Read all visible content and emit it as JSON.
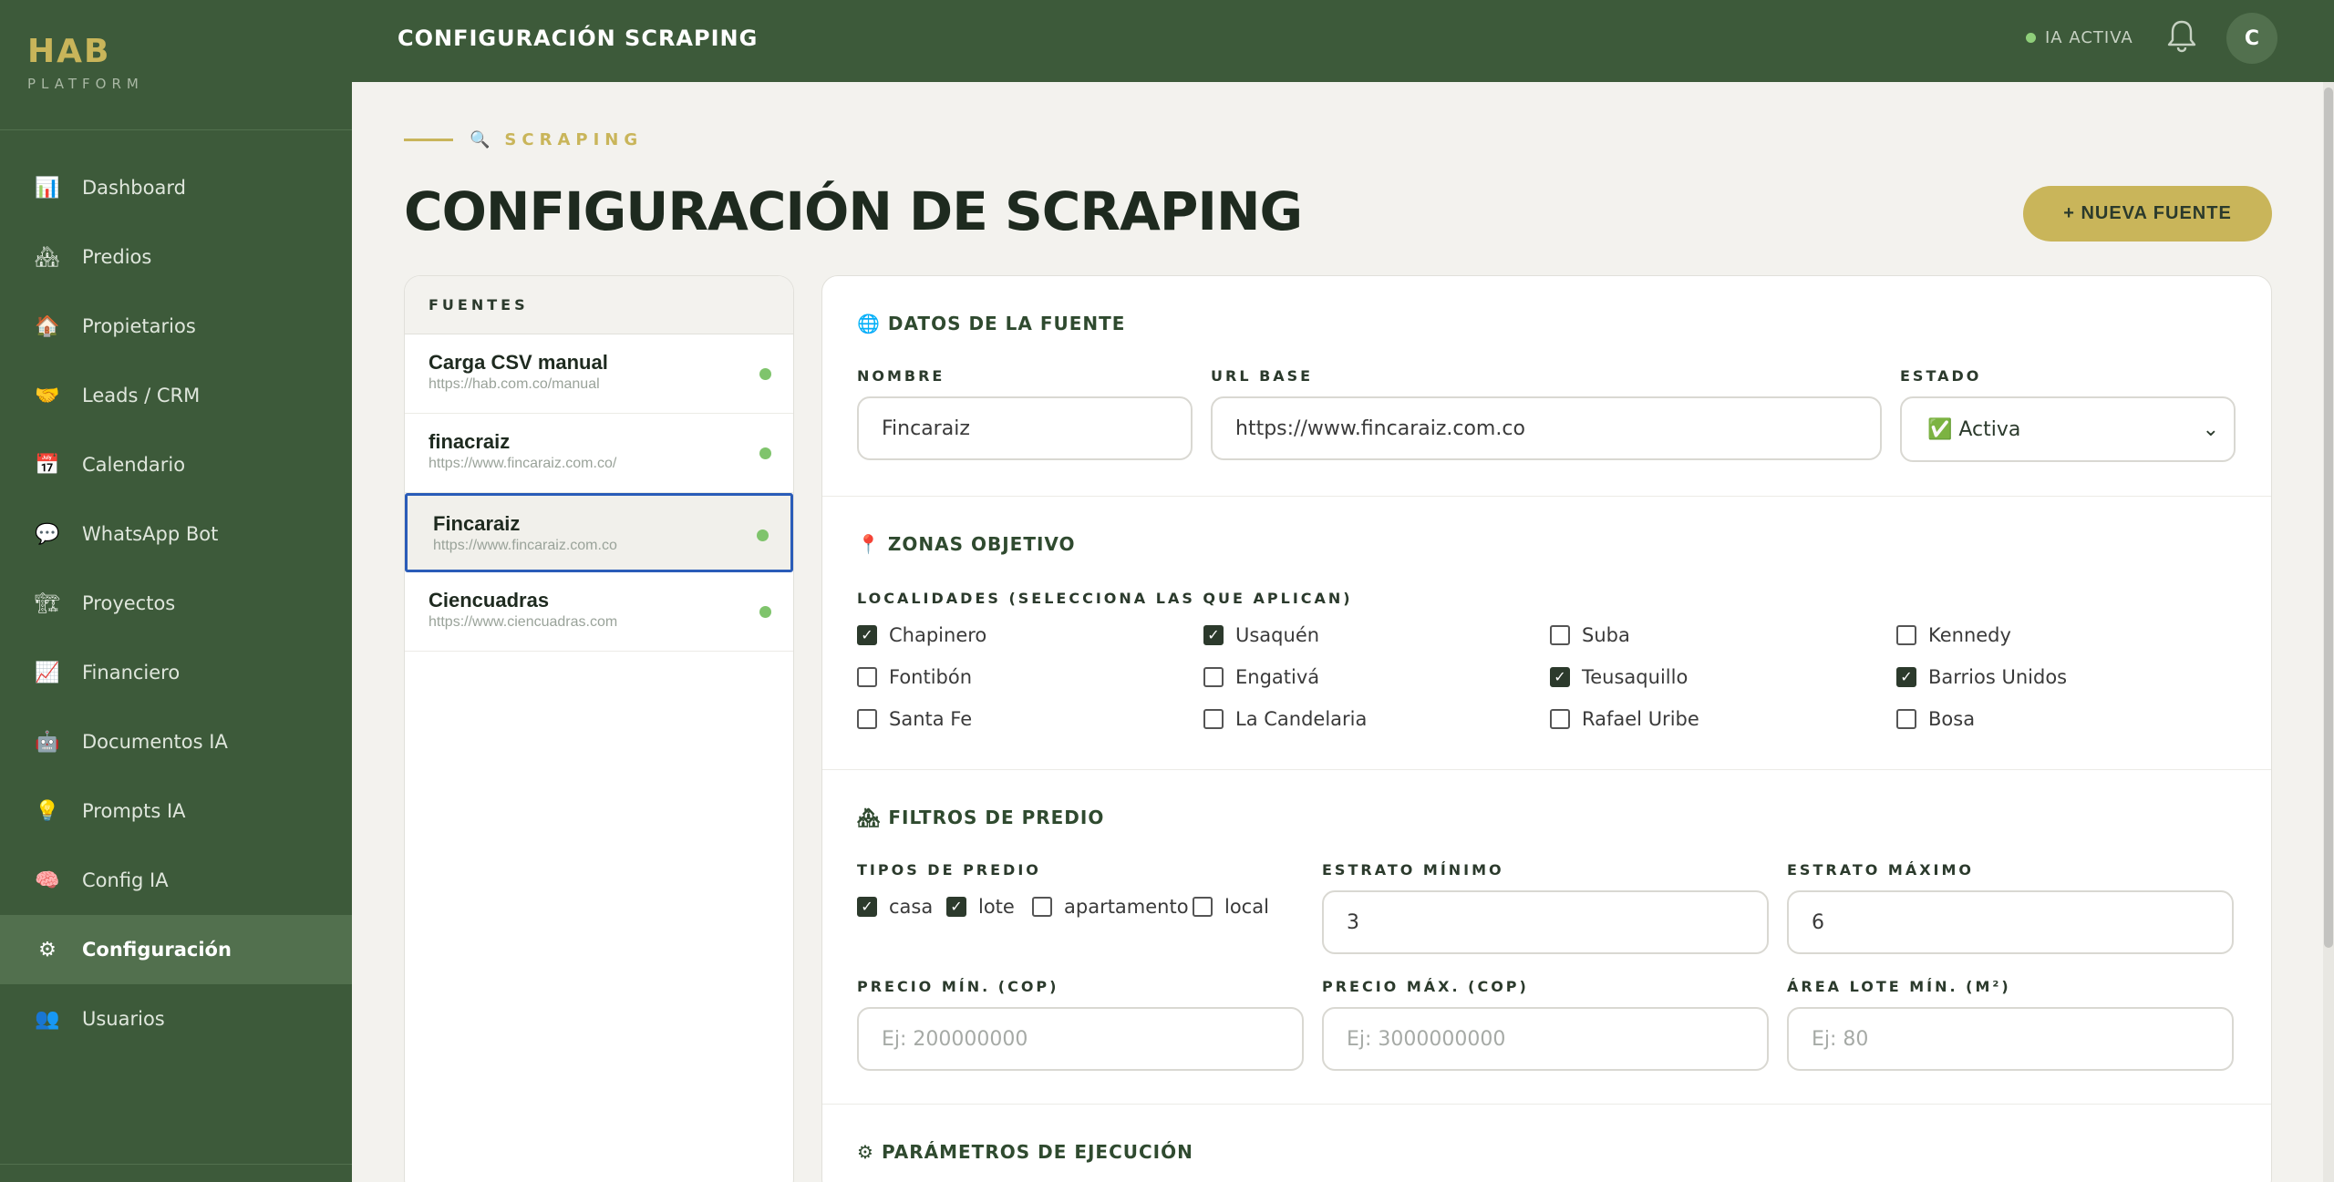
{
  "brand": {
    "name": "HAB",
    "sub": "PLATFORM"
  },
  "header": {
    "title": "CONFIGURACIÓN SCRAPING",
    "ia_status": "IA ACTIVA",
    "avatar_initial": "C"
  },
  "sidebar": {
    "items": [
      {
        "label": "Dashboard",
        "icon": "📊",
        "icon_name": "chart-icon"
      },
      {
        "label": "Predios",
        "icon": "🏘",
        "icon_name": "houses-icon"
      },
      {
        "label": "Propietarios",
        "icon": "🏠",
        "icon_name": "house-icon"
      },
      {
        "label": "Leads / CRM",
        "icon": "🤝",
        "icon_name": "handshake-icon"
      },
      {
        "label": "Calendario",
        "icon": "📅",
        "icon_name": "calendar-icon"
      },
      {
        "label": "WhatsApp Bot",
        "icon": "💬",
        "icon_name": "chat-icon"
      },
      {
        "label": "Proyectos",
        "icon": "🏗",
        "icon_name": "construction-icon"
      },
      {
        "label": "Financiero",
        "icon": "📈",
        "icon_name": "trend-icon"
      },
      {
        "label": "Documentos IA",
        "icon": "🤖",
        "icon_name": "robot-icon"
      },
      {
        "label": "Prompts IA",
        "icon": "💡",
        "icon_name": "bulb-icon"
      },
      {
        "label": "Config IA",
        "icon": "🧠",
        "icon_name": "brain-icon"
      },
      {
        "label": "Configuración",
        "icon": "⚙",
        "icon_name": "gear-icon",
        "active": true
      },
      {
        "label": "Usuarios",
        "icon": "👥",
        "icon_name": "users-icon"
      }
    ]
  },
  "page": {
    "eyebrow": "SCRAPING",
    "eyebrow_icon": "🔍",
    "title": "CONFIGURACIÓN DE SCRAPING",
    "new_source_label": "+ NUEVA FUENTE"
  },
  "sources": {
    "header": "FUENTES",
    "items": [
      {
        "name": "Carga CSV manual",
        "url": "https://hab.com.co/manual"
      },
      {
        "name": "finacraiz",
        "url": "https://www.fincaraiz.com.co/"
      },
      {
        "name": "Fincaraiz",
        "url": "https://www.fincaraiz.com.co",
        "selected": true
      },
      {
        "name": "Ciencuadras",
        "url": "https://www.ciencuadras.com"
      }
    ]
  },
  "form": {
    "datos": {
      "title": "DATOS DE LA FUENTE",
      "icon": "🌐",
      "nombre_label": "NOMBRE",
      "nombre_value": "Fincaraiz",
      "url_label": "URL BASE",
      "url_value": "https://www.fincaraiz.com.co",
      "estado_label": "ESTADO",
      "estado_value": "✅ Activa"
    },
    "zonas": {
      "title": "ZONAS OBJETIVO",
      "icon": "📍",
      "localidades_label": "LOCALIDADES (SELECCIONA LAS QUE APLICAN)",
      "localidades": [
        {
          "label": "Chapinero",
          "checked": true
        },
        {
          "label": "Usaquén",
          "checked": true
        },
        {
          "label": "Suba",
          "checked": false
        },
        {
          "label": "Kennedy",
          "checked": false
        },
        {
          "label": "Fontibón",
          "checked": false
        },
        {
          "label": "Engativá",
          "checked": false
        },
        {
          "label": "Teusaquillo",
          "checked": true
        },
        {
          "label": "Barrios Unidos",
          "checked": true
        },
        {
          "label": "Santa Fe",
          "checked": false
        },
        {
          "label": "La Candelaria",
          "checked": false
        },
        {
          "label": "Rafael Uribe",
          "checked": false
        },
        {
          "label": "Bosa",
          "checked": false
        }
      ]
    },
    "filtros": {
      "title": "FILTROS DE PREDIO",
      "icon": "🏘",
      "tipos_label": "TIPOS DE PREDIO",
      "tipos": [
        {
          "label": "casa",
          "checked": true
        },
        {
          "label": "lote",
          "checked": true
        },
        {
          "label": "apartamento",
          "checked": false
        },
        {
          "label": "local",
          "checked": false
        }
      ],
      "estrato_min_label": "ESTRATO MÍNIMO",
      "estrato_min_value": "3",
      "estrato_max_label": "ESTRATO MÁXIMO",
      "estrato_max_value": "6",
      "precio_min_label": "PRECIO MÍN. (COP)",
      "precio_min_placeholder": "Ej: 200000000",
      "precio_max_label": "PRECIO MÁX. (COP)",
      "precio_max_placeholder": "Ej: 3000000000",
      "area_label": "ÁREA LOTE MÍN. (M²)",
      "area_placeholder": "Ej: 80"
    },
    "parametros": {
      "title": "PARÁMETROS DE EJECUCIÓN",
      "icon": "⚙"
    }
  },
  "colors": {
    "sidebar_bg": "#3d5a3a",
    "accent_gold": "#c9b55a",
    "active_dot": "#7fc46c",
    "selected_border": "#2a5cb8"
  }
}
